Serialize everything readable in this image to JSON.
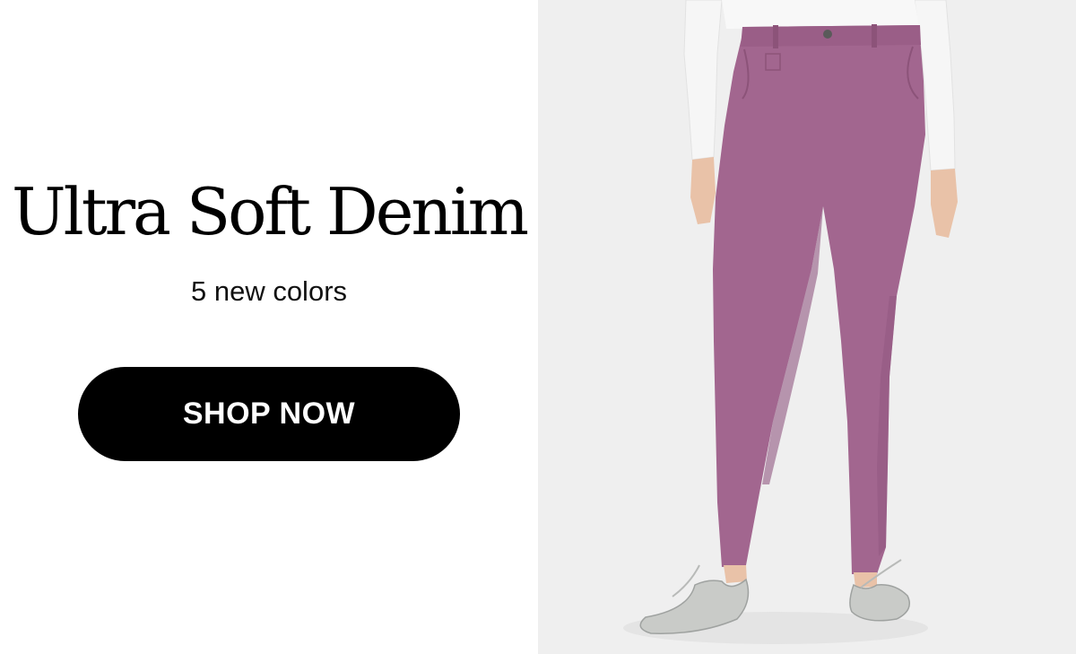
{
  "promo": {
    "headline": "Ultra Soft Denim",
    "subhead": "5 new colors",
    "cta_label": "SHOP NOW"
  },
  "colors": {
    "background": "#ffffff",
    "button": "#000000",
    "button_text": "#ffffff",
    "image_background": "#efefef",
    "pants": "#a2668f",
    "shirt": "#f5f5f5",
    "shoes": "#c9cbc8"
  },
  "image": {
    "subject": "model-wearing-mauve-jeggings-icon"
  }
}
